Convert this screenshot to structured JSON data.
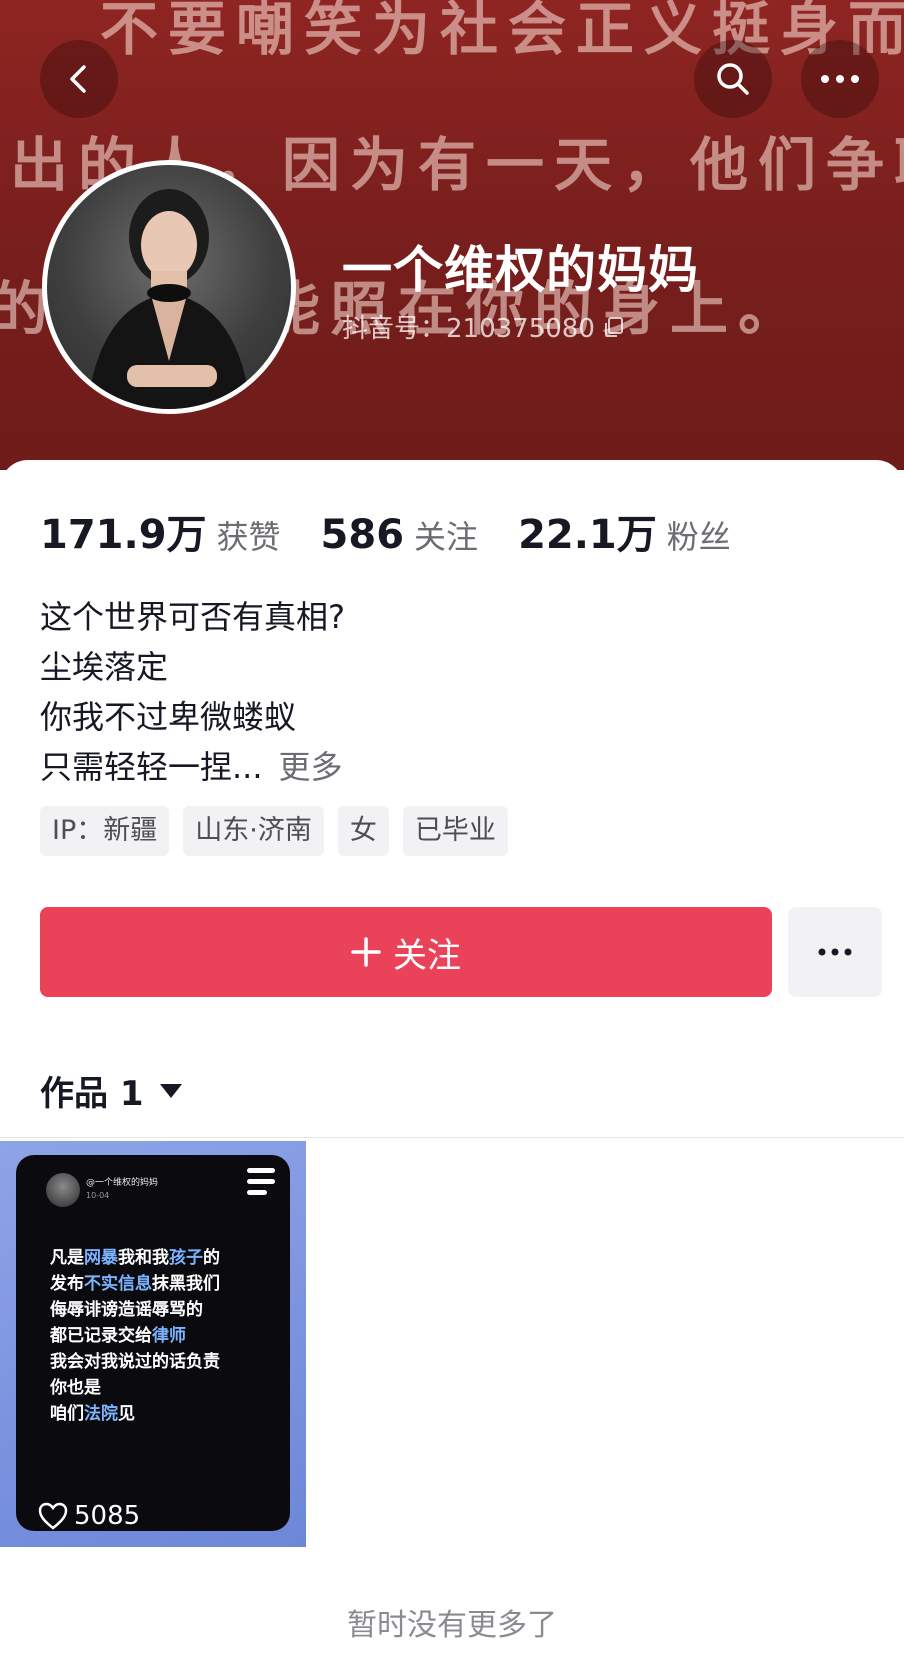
{
  "banner": {
    "background_text": [
      "不要嘲笑为社会正义挺身而",
      "出的人，因为有一天，他们争取",
      "的利益可能照在你的身上。"
    ],
    "background_color": "#7a1f1d"
  },
  "header": {
    "back_icon": "chevron-left-icon",
    "search_icon": "search-icon",
    "more_icon": "ellipsis-icon"
  },
  "profile": {
    "display_name": "一个维权的妈妈",
    "douyin_id": "抖音号：210375080"
  },
  "stats": [
    {
      "value": "171.9万",
      "label": "获赞"
    },
    {
      "value": "586",
      "label": "关注"
    },
    {
      "value": "22.1万",
      "label": "粉丝"
    }
  ],
  "bio": {
    "lines": [
      "这个世界可否有真相?",
      "尘埃落定",
      "你我不过卑微蝼蚁",
      "只需轻轻一捏..."
    ],
    "more_label": "更多"
  },
  "tags": [
    "IP：新疆",
    "山东·济南",
    "女",
    "已毕业"
  ],
  "actions": {
    "follow_label": "关注",
    "accent_color": "#ea4359"
  },
  "works": {
    "tab_label": "作品 1",
    "items": [
      {
        "post_handle": "@一个维权的妈妈",
        "post_date": "10-04",
        "text_lines": [
          [
            {
              "t": "凡是",
              "h": false
            },
            {
              "t": "网暴",
              "h": true
            },
            {
              "t": "我和我",
              "h": false
            },
            {
              "t": "孩子",
              "h": true
            },
            {
              "t": "的",
              "h": false
            }
          ],
          [
            {
              "t": "发布",
              "h": false
            },
            {
              "t": "不实信息",
              "h": true
            },
            {
              "t": "抹黑我们",
              "h": false
            }
          ],
          [
            {
              "t": "侮辱诽谤造谣辱骂的",
              "h": false
            }
          ],
          [
            {
              "t": "都已记录交给",
              "h": false
            },
            {
              "t": "律师",
              "h": true
            }
          ],
          [
            {
              "t": "我会对我说过的话负责",
              "h": false
            }
          ],
          [
            {
              "t": "你也是",
              "h": false
            }
          ],
          [
            {
              "t": "咱们",
              "h": false
            },
            {
              "t": "法院",
              "h": true
            },
            {
              "t": "见",
              "h": false
            }
          ]
        ],
        "likes": "5085"
      }
    ],
    "empty_note": "暂时没有更多了"
  }
}
